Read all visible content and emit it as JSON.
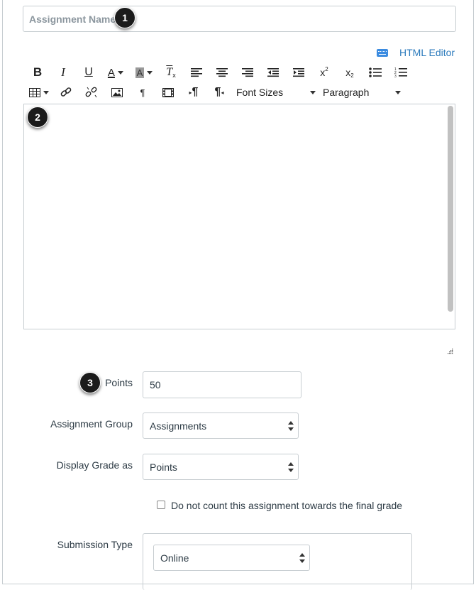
{
  "form": {
    "assignment_name_placeholder": "Assignment Name",
    "assignment_name_value": ""
  },
  "badges": [
    "1",
    "2",
    "3"
  ],
  "editor": {
    "html_editor_label": "HTML Editor",
    "html_editor_icon": "keyboard-icon",
    "font_sizes_label": "Font Sizes",
    "paragraph_label": "Paragraph",
    "toolbar_row1": [
      "bold",
      "italic",
      "underline",
      "text-color",
      "background-color",
      "clear-formatting",
      "align-left",
      "align-center",
      "align-right",
      "outdent",
      "indent",
      "superscript",
      "subscript",
      "bullet-list",
      "numbered-list"
    ],
    "toolbar_row2": [
      "table",
      "link",
      "unlink",
      "image",
      "show-blocks",
      "media",
      "ltr",
      "rtl"
    ]
  },
  "points": {
    "label": "Points",
    "value": "50"
  },
  "assignment_group": {
    "label": "Assignment Group",
    "value": "Assignments"
  },
  "display_grade": {
    "label": "Display Grade as",
    "value": "Points"
  },
  "final_grade_checkbox": {
    "label": "Do not count this assignment towards the final grade",
    "checked": false
  },
  "submission_type": {
    "label": "Submission Type",
    "value": "Online"
  },
  "colors": {
    "link": "#2b7abc",
    "border": "#c7cdd1",
    "badge": "#1b1b1b"
  }
}
